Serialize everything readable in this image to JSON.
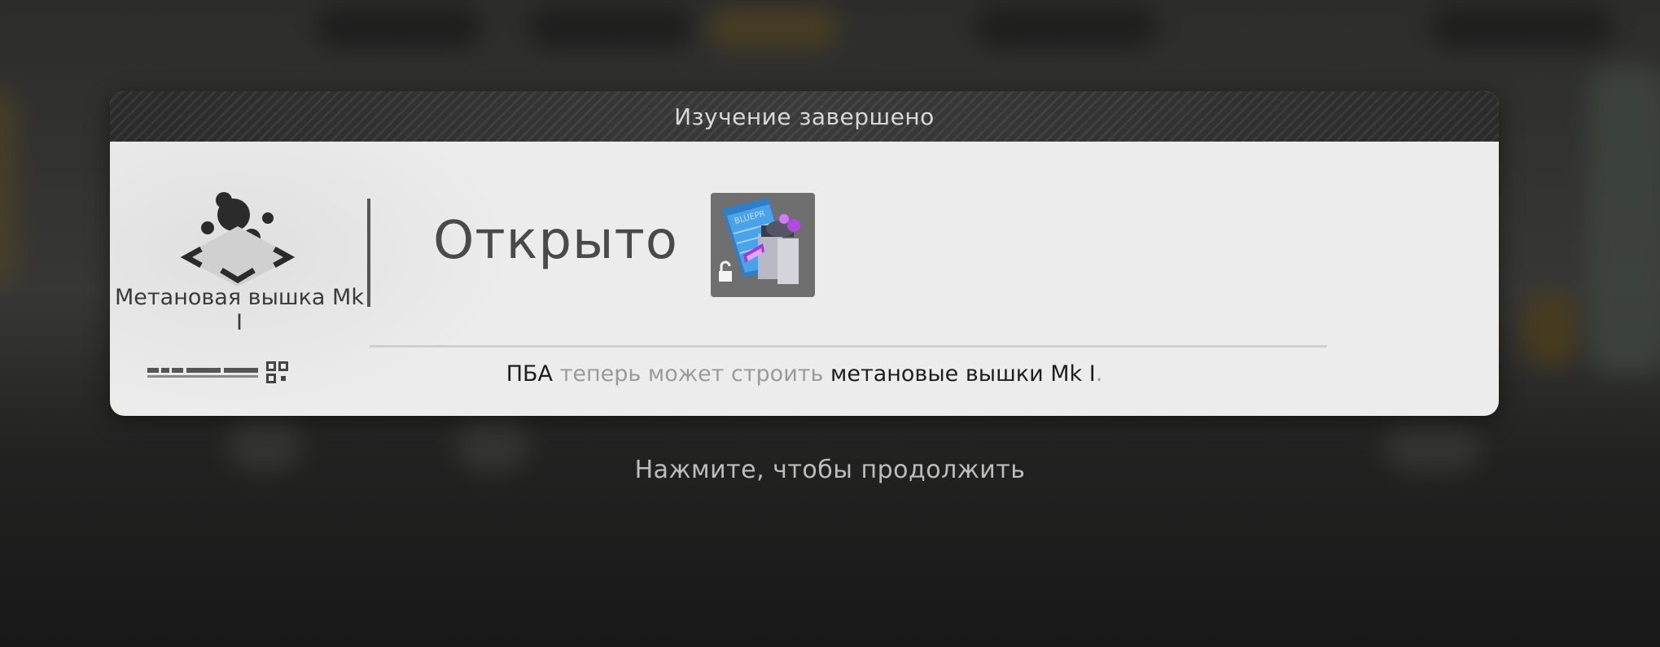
{
  "dialog": {
    "title": "Изучение завершено",
    "item_name": "Метановая вышка Mk I",
    "status_label": "Открыто",
    "item_icon": "methane-tower-icon",
    "unlock_icon": "blueprint-unlock-icon",
    "description": {
      "subject": "ПБА",
      "verb": " теперь может строить ",
      "object": "метановые вышки Mk I",
      "end": "."
    }
  },
  "continue_hint": "Нажмите, чтобы продолжить",
  "colors": {
    "panel_bg": "#ececec",
    "header_bg": "#2f2f2f",
    "accent_blue": "#3a8fd6",
    "accent_purple": "#a13ad6"
  }
}
